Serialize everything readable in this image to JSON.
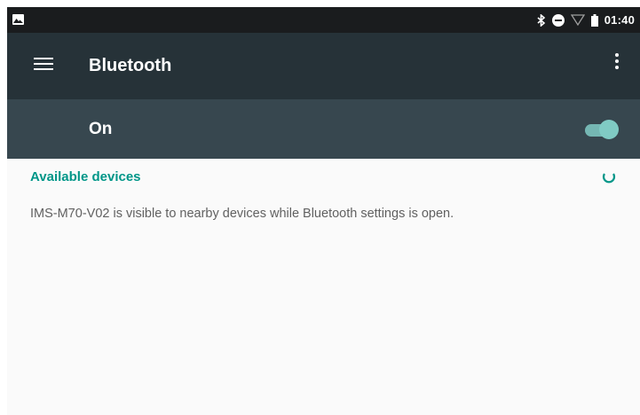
{
  "status_bar": {
    "time": "01:40",
    "icons": [
      "image-notification-icon",
      "bluetooth-icon",
      "do-not-disturb-icon",
      "wifi-icon",
      "battery-icon"
    ]
  },
  "toolbar": {
    "title": "Bluetooth",
    "menu_icon": "menu-icon",
    "overflow_icon": "more-vert-icon"
  },
  "master_switch": {
    "label": "On",
    "checked": true
  },
  "available_devices": {
    "header": "Available devices",
    "scanning_icon": "progress-spinner-icon",
    "visibility_text": "IMS-M70-V02 is visible to nearby devices while Bluetooth settings is open."
  },
  "colors": {
    "status_bar": "#1a1c1e",
    "toolbar": "#263238",
    "switch_bar": "#37474f",
    "accent": "#009688",
    "switch_on": "#80cbc4",
    "background": "#fafafa"
  }
}
